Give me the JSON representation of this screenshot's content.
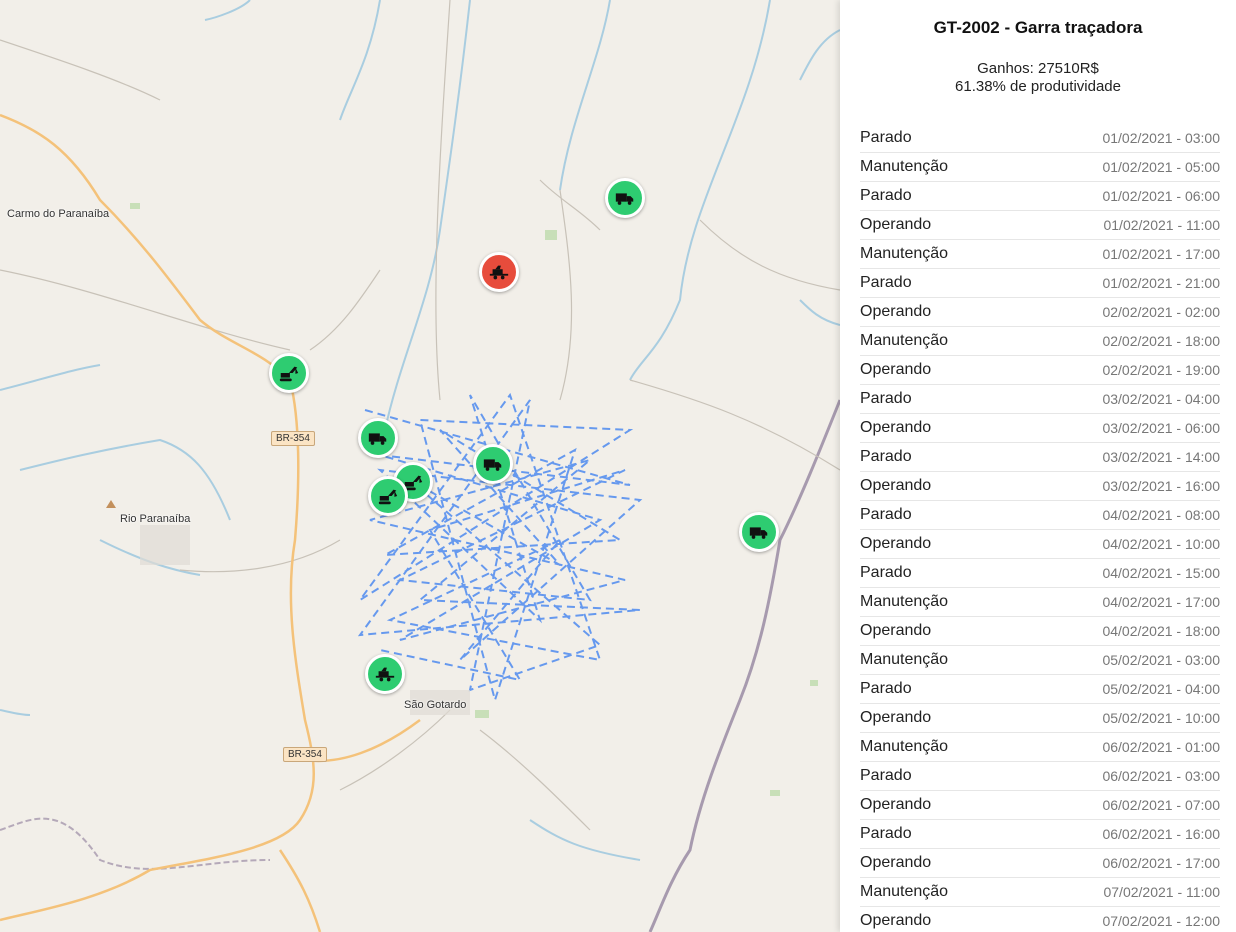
{
  "map": {
    "places": [
      {
        "name": "Carmo do Paranaíba"
      },
      {
        "name": "Rio Paranaíba"
      },
      {
        "name": "São Gotardo"
      }
    ],
    "roads": [
      "BR-354",
      "BR-354"
    ],
    "colors": {
      "operating": "#2ecc71",
      "stopped": "#e74c3c",
      "route": "#6699ee"
    },
    "markers": [
      {
        "type": "truck-icon",
        "status": "operating"
      },
      {
        "type": "harvester-icon",
        "status": "stopped"
      },
      {
        "type": "excavator-icon",
        "status": "operating"
      },
      {
        "type": "truck-icon",
        "status": "operating"
      },
      {
        "type": "excavator-icon",
        "status": "operating"
      },
      {
        "type": "excavator-icon",
        "status": "operating"
      },
      {
        "type": "truck-icon",
        "status": "operating"
      },
      {
        "type": "truck-icon",
        "status": "operating"
      },
      {
        "type": "harvester-icon",
        "status": "operating"
      }
    ]
  },
  "panel": {
    "title": "GT-2002 - Garra traçadora",
    "earnings": "Ganhos: 27510R$",
    "productivity": "61.38% de produtividade",
    "events": [
      {
        "status": "Parado",
        "datetime": "01/02/2021 - 03:00"
      },
      {
        "status": "Manutenção",
        "datetime": "01/02/2021 - 05:00"
      },
      {
        "status": "Parado",
        "datetime": "01/02/2021 - 06:00"
      },
      {
        "status": "Operando",
        "datetime": "01/02/2021 - 11:00"
      },
      {
        "status": "Manutenção",
        "datetime": "01/02/2021 - 17:00"
      },
      {
        "status": "Parado",
        "datetime": "01/02/2021 - 21:00"
      },
      {
        "status": "Operando",
        "datetime": "02/02/2021 - 02:00"
      },
      {
        "status": "Manutenção",
        "datetime": "02/02/2021 - 18:00"
      },
      {
        "status": "Operando",
        "datetime": "02/02/2021 - 19:00"
      },
      {
        "status": "Parado",
        "datetime": "03/02/2021 - 04:00"
      },
      {
        "status": "Operando",
        "datetime": "03/02/2021 - 06:00"
      },
      {
        "status": "Parado",
        "datetime": "03/02/2021 - 14:00"
      },
      {
        "status": "Operando",
        "datetime": "03/02/2021 - 16:00"
      },
      {
        "status": "Parado",
        "datetime": "04/02/2021 - 08:00"
      },
      {
        "status": "Operando",
        "datetime": "04/02/2021 - 10:00"
      },
      {
        "status": "Parado",
        "datetime": "04/02/2021 - 15:00"
      },
      {
        "status": "Manutenção",
        "datetime": "04/02/2021 - 17:00"
      },
      {
        "status": "Operando",
        "datetime": "04/02/2021 - 18:00"
      },
      {
        "status": "Manutenção",
        "datetime": "05/02/2021 - 03:00"
      },
      {
        "status": "Parado",
        "datetime": "05/02/2021 - 04:00"
      },
      {
        "status": "Operando",
        "datetime": "05/02/2021 - 10:00"
      },
      {
        "status": "Manutenção",
        "datetime": "06/02/2021 - 01:00"
      },
      {
        "status": "Parado",
        "datetime": "06/02/2021 - 03:00"
      },
      {
        "status": "Operando",
        "datetime": "06/02/2021 - 07:00"
      },
      {
        "status": "Parado",
        "datetime": "06/02/2021 - 16:00"
      },
      {
        "status": "Operando",
        "datetime": "06/02/2021 - 17:00"
      },
      {
        "status": "Manutenção",
        "datetime": "07/02/2021 - 11:00"
      },
      {
        "status": "Operando",
        "datetime": "07/02/2021 - 12:00"
      }
    ]
  }
}
